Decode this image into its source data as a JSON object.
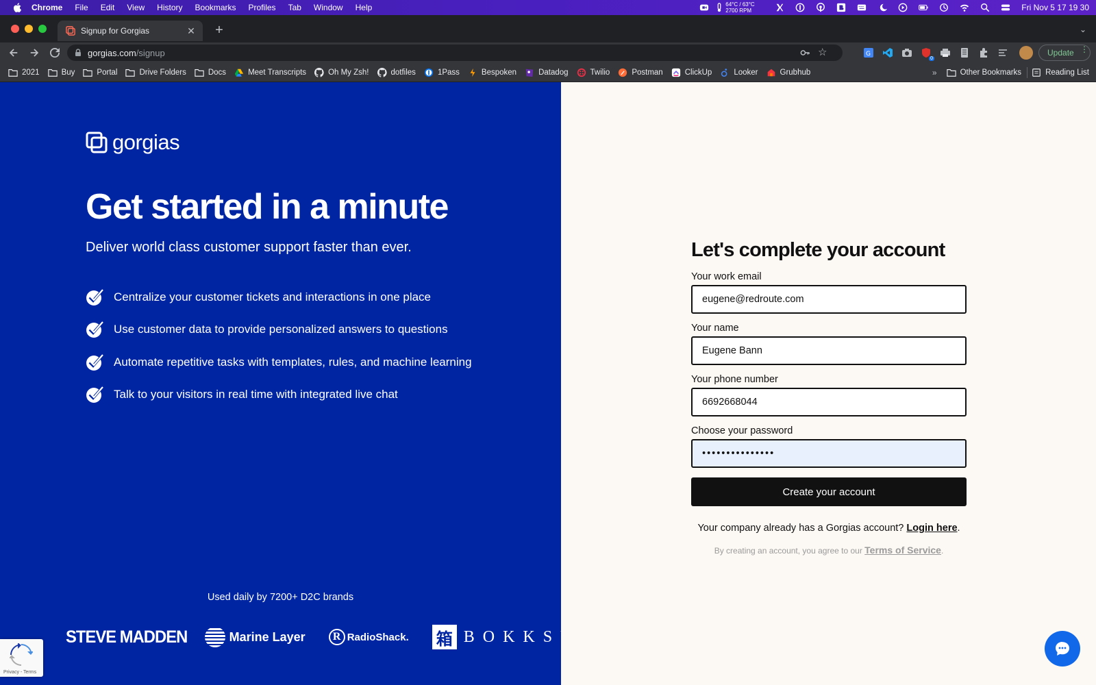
{
  "menubar": {
    "app": "Chrome",
    "items": [
      "File",
      "Edit",
      "View",
      "History",
      "Bookmarks",
      "Profiles",
      "Tab",
      "Window",
      "Help"
    ],
    "temp_line1": "64°C / 63°C",
    "temp_line2": "2700 RPM",
    "clock": "Fri Nov 5  17 19 30"
  },
  "browser": {
    "tab_title": "Signup for Gorgias",
    "url_host": "gorgias.com",
    "url_path": "/signup",
    "update_label": "Update",
    "extension_badge": "0"
  },
  "bookmarks": {
    "items": [
      {
        "label": "2021",
        "icon": "folder-icon"
      },
      {
        "label": "Buy",
        "icon": "folder-icon"
      },
      {
        "label": "Portal",
        "icon": "folder-icon"
      },
      {
        "label": "Drive Folders",
        "icon": "folder-icon"
      },
      {
        "label": "Docs",
        "icon": "folder-icon"
      },
      {
        "label": "Meet Transcripts",
        "icon": "drive-icon"
      },
      {
        "label": "Oh My Zsh!",
        "icon": "github-icon"
      },
      {
        "label": "dotfiles",
        "icon": "github-icon"
      },
      {
        "label": "1Pass",
        "icon": "onepassword-icon"
      },
      {
        "label": "Bespoken",
        "icon": "bespoken-icon"
      },
      {
        "label": "Datadog",
        "icon": "datadog-icon"
      },
      {
        "label": "Twilio",
        "icon": "twilio-icon"
      },
      {
        "label": "Postman",
        "icon": "postman-icon"
      },
      {
        "label": "ClickUp",
        "icon": "clickup-icon"
      },
      {
        "label": "Looker",
        "icon": "looker-icon"
      },
      {
        "label": "Grubhub",
        "icon": "grubhub-icon"
      }
    ],
    "overflow": "»",
    "other": "Other Bookmarks",
    "reading_list": "Reading List"
  },
  "hero": {
    "logo_text": "gorgias",
    "title": "Get started in a minute",
    "subtitle": "Deliver world class customer support faster than ever.",
    "features": [
      "Centralize your customer tickets and interactions in one place",
      "Use customer data to provide personalized answers to questions",
      "Automate repetitive tasks with templates, rules, and machine learning",
      "Talk to your visitors in real time with integrated live chat"
    ],
    "used_by": "Used daily by 7200+ D2C brands",
    "brands": {
      "steve_madden": "STEVE MADDEN",
      "marine_layer": "Marine Layer",
      "radioshack": "RadioShack.",
      "bokksu_mark": "箱",
      "bokksu": "BOKKSU"
    },
    "recaptcha_text": "Privacy - Terms"
  },
  "form": {
    "title": "Let's complete your account",
    "email_label": "Your work email",
    "email_value": "eugene@redroute.com",
    "name_label": "Your name",
    "name_value": "Eugene Bann",
    "phone_label": "Your phone number",
    "phone_value": "6692668044",
    "password_label": "Choose your password",
    "password_value": "•••••••••••••••",
    "submit_label": "Create your account",
    "login_prefix": "Your company already has a Gorgias account?",
    "login_link": "Login here",
    "login_suffix": ".",
    "tos_prefix": "By creating an account, you agree to our",
    "tos_link": "Terms of Service",
    "tos_suffix": "."
  },
  "colors": {
    "hero_bg": "#0025a3",
    "form_bg": "#fcf8f3",
    "button_bg": "#111111",
    "chat_bubble": "#1168e8"
  }
}
